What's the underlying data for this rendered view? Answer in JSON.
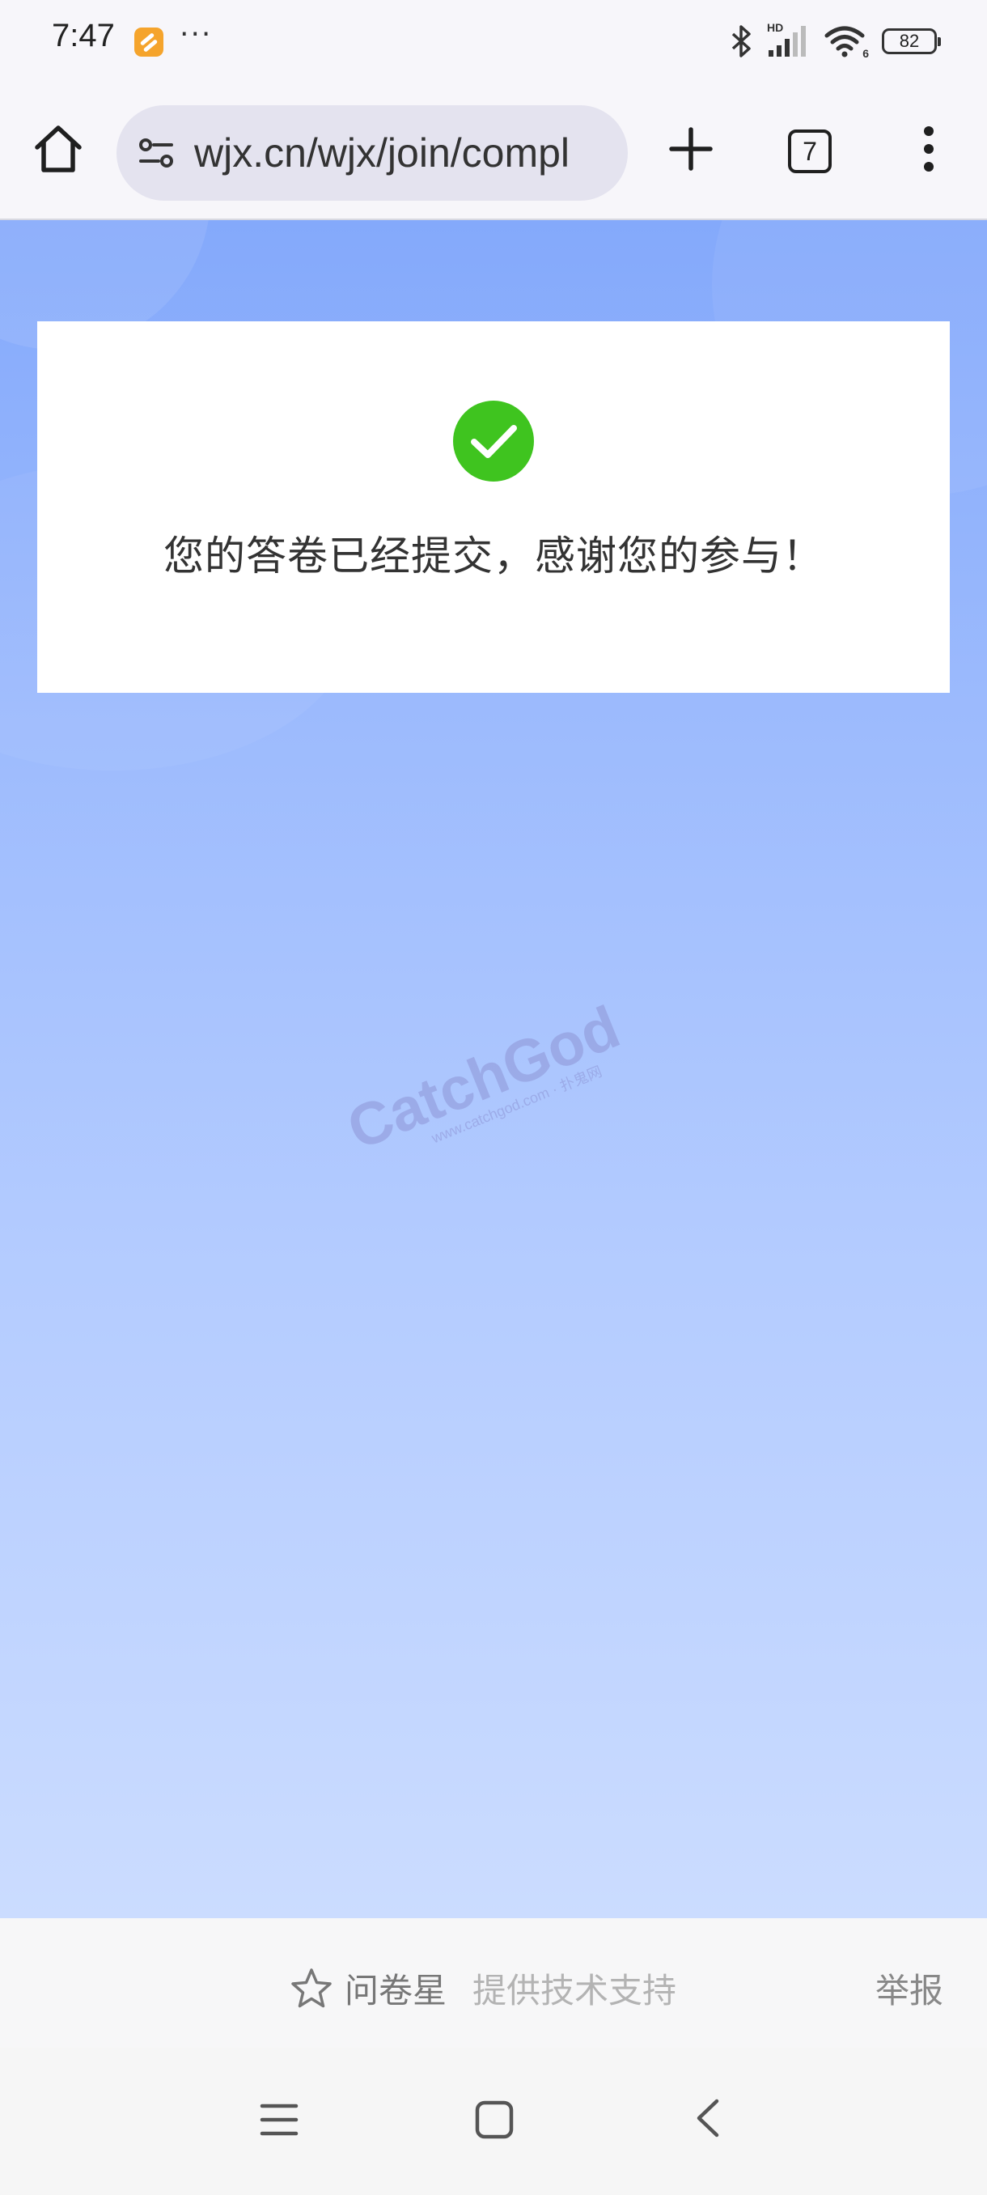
{
  "status_bar": {
    "time": "7:47",
    "more": "···",
    "network_label": "HD",
    "wifi_label": "6",
    "battery": "82"
  },
  "toolbar": {
    "url": "wjx.cn/wjx/join/compl",
    "tab_count": "7"
  },
  "card": {
    "message": "您的答卷已经提交，感谢您的参与！"
  },
  "watermark": {
    "logo": "CatchGod",
    "url": "www.catchgod.com · 扑鬼网"
  },
  "footer": {
    "brand": "问卷星",
    "support_text": "提供技术支持",
    "report": "举报"
  },
  "colors": {
    "success_green": "#3fc41f",
    "bg_top": "#84a9fb",
    "bg_bottom": "#cbdcff"
  }
}
